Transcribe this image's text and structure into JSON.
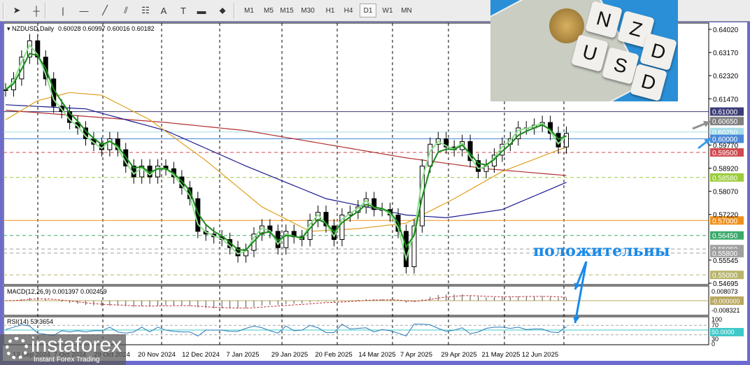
{
  "toolbar": {
    "tools": [
      "cursor",
      "crosshair",
      "vertical-line",
      "horizontal-line",
      "trendline",
      "fibonacci",
      "fibo-fan",
      "text",
      "text-label",
      "rectangle",
      "arrows"
    ],
    "text_tool": "A",
    "timeframes": [
      "M1",
      "M5",
      "M15",
      "M30",
      "H1",
      "H4",
      "D1",
      "W1",
      "MN"
    ],
    "selected_timeframe": "D1"
  },
  "chart": {
    "symbol": "NZDUSD,Daily",
    "ohlc": "0.60028 0.60997 0.60016 0.60182",
    "price_labels": [
      "0.64020",
      "0.63170",
      "0.62320",
      "0.61470",
      "0.59770",
      "0.58920",
      "0.58070",
      "0.57220",
      "0.55545",
      "0.54695"
    ],
    "price_values": [
      0.6402,
      0.6317,
      0.6232,
      0.6147,
      0.5977,
      0.5892,
      0.5807,
      0.5722,
      0.55545,
      0.54695
    ],
    "levels": [
      {
        "label": "0.61000",
        "value": 0.61,
        "color": "#3c3c78",
        "style": "solid"
      },
      {
        "label": "0.60650",
        "value": 0.6065,
        "color": "#808080",
        "style": "none"
      },
      {
        "label": "0.60250",
        "value": 0.6025,
        "color": "#a8dce8",
        "style": "solid"
      },
      {
        "label": "0.60000",
        "value": 0.6,
        "color": "#4a88d8",
        "style": "solid"
      },
      {
        "label": "0.59500",
        "value": 0.595,
        "color": "#d04a50",
        "style": "dash"
      },
      {
        "label": "0.58580",
        "value": 0.5858,
        "color": "#9ccc3a",
        "style": "dash"
      },
      {
        "label": "0.57000",
        "value": 0.57,
        "color": "#f0901a",
        "style": "solid"
      },
      {
        "label": "0.56450",
        "value": 0.5645,
        "color": "#3aaa6a",
        "style": "dash"
      },
      {
        "label": "0.55950",
        "value": 0.5595,
        "color": "#a0a0a0",
        "style": "dash"
      },
      {
        "label": "0.55800",
        "value": 0.558,
        "color": "#a0a0a0",
        "style": "dash"
      },
      {
        "label": "0.55000",
        "value": 0.55,
        "color": "#b8b46a",
        "style": "dash"
      }
    ],
    "dates": [
      "13 Sep 2024",
      "7 Oct 2024",
      "29 Oct 2024",
      "20 Nov 2024",
      "12 Dec 2024",
      "7 Jan 2025",
      "29 Jan 2025",
      "20 Feb 2025",
      "14 Mar 2025",
      "7 Apr 2025",
      "29 Apr 2025",
      "21 May 2025",
      "12 Jun 2025"
    ]
  },
  "chart_data": {
    "type": "line",
    "title": "NZDUSD,Daily",
    "ylim": [
      0.54695,
      0.6402
    ],
    "closes": [
      0.618,
      0.622,
      0.63,
      0.636,
      0.63,
      0.622,
      0.612,
      0.61,
      0.606,
      0.604,
      0.6,
      0.598,
      0.596,
      0.6,
      0.596,
      0.59,
      0.586,
      0.59,
      0.586,
      0.59,
      0.589,
      0.586,
      0.582,
      0.578,
      0.566,
      0.565,
      0.564,
      0.563,
      0.56,
      0.557,
      0.559,
      0.565,
      0.568,
      0.566,
      0.56,
      0.566,
      0.564,
      0.563,
      0.57,
      0.573,
      0.568,
      0.563,
      0.572,
      0.573,
      0.575,
      0.578,
      0.574,
      0.574,
      0.572,
      0.566,
      0.553,
      0.568,
      0.59,
      0.598,
      0.6,
      0.597,
      0.596,
      0.599,
      0.592,
      0.588,
      0.59,
      0.594,
      0.598,
      0.6,
      0.604,
      0.604,
      0.605,
      0.606,
      0.602,
      0.597,
      0.602
    ],
    "ma_red": [
      [
        0,
        0.6105
      ],
      [
        20,
        0.606
      ],
      [
        30,
        0.603
      ],
      [
        40,
        0.598
      ],
      [
        50,
        0.593
      ],
      [
        60,
        0.589
      ],
      [
        70,
        0.5865
      ]
    ],
    "ma_blue": [
      [
        0,
        0.6125
      ],
      [
        10,
        0.611
      ],
      [
        20,
        0.603
      ],
      [
        30,
        0.59
      ],
      [
        40,
        0.578
      ],
      [
        50,
        0.572
      ],
      [
        55,
        0.571
      ],
      [
        62,
        0.574
      ],
      [
        70,
        0.584
      ]
    ],
    "ma_orange": [
      [
        0,
        0.607
      ],
      [
        4,
        0.614
      ],
      [
        8,
        0.617
      ],
      [
        12,
        0.616
      ],
      [
        18,
        0.607
      ],
      [
        25,
        0.592
      ],
      [
        32,
        0.575
      ],
      [
        38,
        0.566
      ],
      [
        44,
        0.567
      ],
      [
        50,
        0.569
      ],
      [
        56,
        0.578
      ],
      [
        62,
        0.588
      ],
      [
        70,
        0.597
      ]
    ]
  },
  "macd": {
    "label": "MACD(12,26,9) 0.001397 0.002459",
    "scale": [
      "0.008073",
      "-0.000000",
      "-0.008321"
    ]
  },
  "rsi": {
    "label": "RSI(14) 53.3654",
    "scale": [
      "100",
      "70",
      "50.0000",
      "30",
      "0"
    ]
  },
  "photo": {
    "tiles": [
      "N",
      "Z",
      "D",
      "U",
      "S",
      "D"
    ]
  },
  "annotation": "положительны",
  "logo": {
    "name": "instaforex",
    "tagline": "Instant Forex Trading"
  }
}
